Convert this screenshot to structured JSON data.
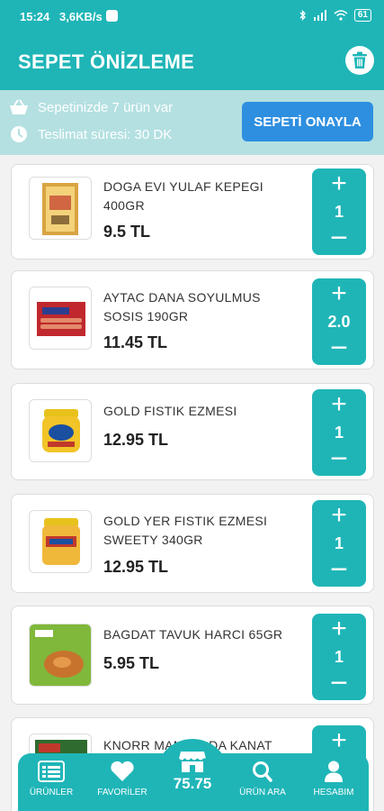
{
  "status_bar": {
    "time": "15:24",
    "speed": "3,6KB/s",
    "battery": "61"
  },
  "header": {
    "title": "SEPET ÖNİZLEME"
  },
  "info": {
    "cart_count_text": "Sepetinizde 7 ürün var",
    "delivery_text": "Teslimat süresi: 30 DK",
    "confirm_label": "SEPETİ ONAYLA"
  },
  "products": [
    {
      "name": "DOGA EVI YULAF KEPEGI 400GR",
      "price": "9.5 TL",
      "qty": "1"
    },
    {
      "name": "AYTAC DANA SOYULMUS SOSIS 190GR",
      "price": "11.45 TL",
      "qty": "2.0"
    },
    {
      "name": "GOLD FISTIK EZMESI",
      "price": "12.95 TL",
      "qty": "1"
    },
    {
      "name": "GOLD YER FISTIK EZMESI SWEETY 340GR",
      "price": "12.95 TL",
      "qty": "1"
    },
    {
      "name": "BAGDAT TAVUK HARCI 65GR",
      "price": "5.95 TL",
      "qty": "1"
    },
    {
      "name": "KNORR MANGALDA KANAT",
      "price": "",
      "qty": ""
    }
  ],
  "qty_controls": {
    "plus": "+",
    "minus": "−"
  },
  "nav": {
    "products_label": "ÜRÜNLER",
    "favorites_label": "FAVORİLER",
    "total": "75.75",
    "search_label": "ÜRÜN ARA",
    "account_label": "HESABIM"
  },
  "colors": {
    "primary": "#1fb5b7",
    "info_bar": "#b4e0e1",
    "confirm_button": "#2e8fe0"
  }
}
